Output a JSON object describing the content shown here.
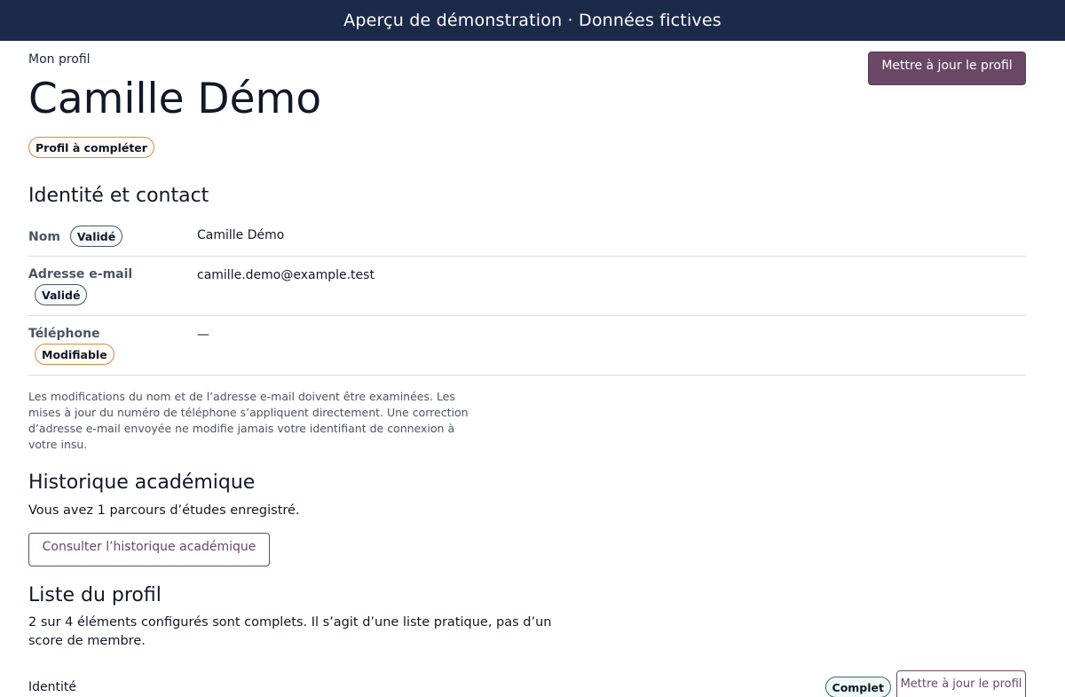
{
  "banner": {
    "text": "Aperçu de démonstration · Données fictives"
  },
  "header": {
    "eyebrow": "Mon profil",
    "name": "Camille Démo",
    "update_button": "Mettre à jour le profil",
    "status_badge": "Profil à compléter"
  },
  "identity": {
    "heading": "Identité et contact",
    "rows": [
      {
        "label": "Nom",
        "badge": "Validé",
        "value": "Camille Démo"
      },
      {
        "label": "Adresse e-mail",
        "badge": "Validé",
        "value": "camille.demo@example.test"
      },
      {
        "label": "Téléphone",
        "badge": "Modifiable",
        "value": "—"
      }
    ],
    "note": "Les modifications du nom et de l’adresse e-mail doivent être examinées. Les mises à jour du numéro de téléphone s’appliquent directement. Une correction d’adresse e-mail envoyée ne modifie jamais votre identifiant de connexion à votre insu."
  },
  "academic": {
    "heading": "Historique académique",
    "summary": "Vous avez 1 parcours d’études enregistré.",
    "button": "Consulter l’historique académique"
  },
  "checklist": {
    "heading": "Liste du profil",
    "summary": "2 sur 4 éléments configurés sont complets. Il s’agit d’une liste pratique, pas d’un score de membre.",
    "items": [
      {
        "label": "Identité",
        "badge": "Complet",
        "button": "Mettre à jour le profil"
      }
    ]
  }
}
